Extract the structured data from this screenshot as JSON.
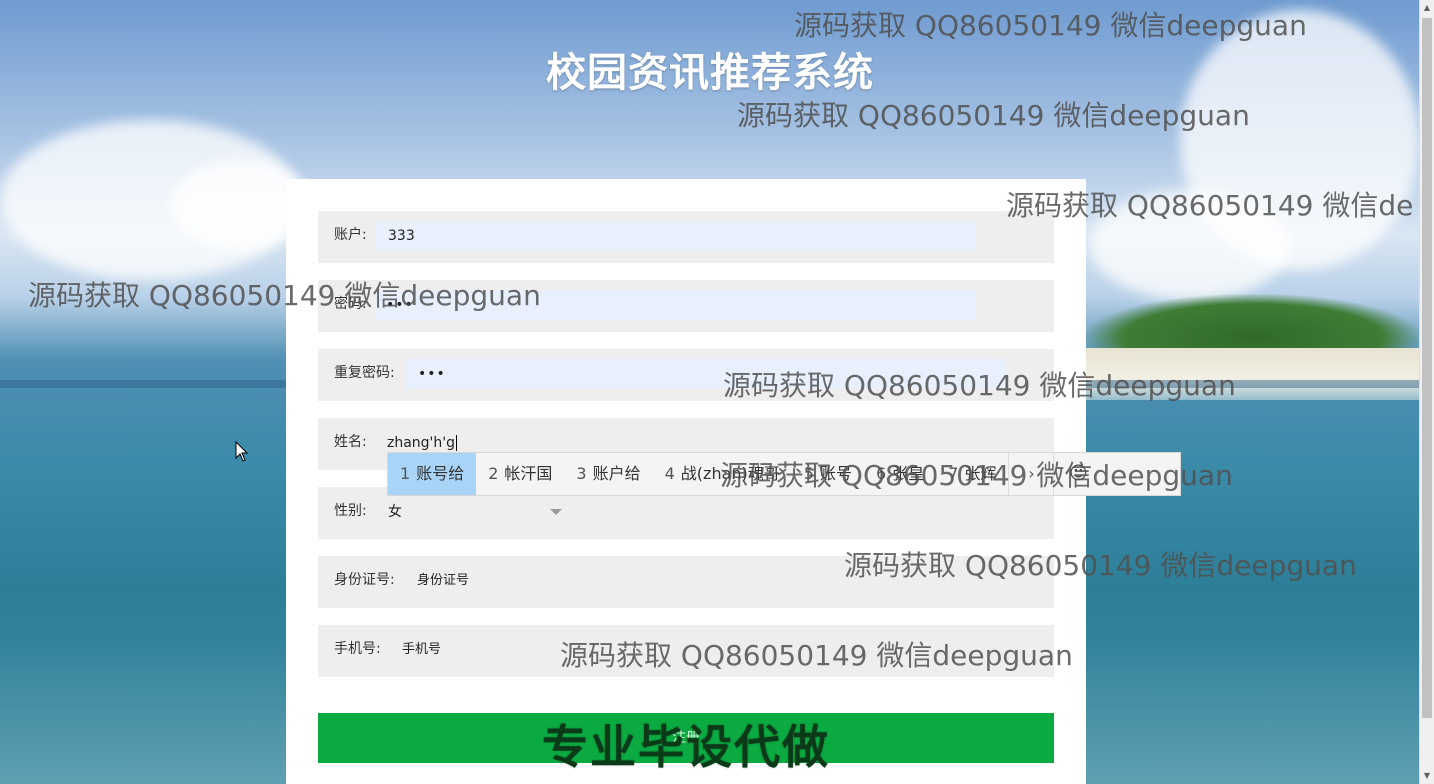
{
  "header": {
    "title": "校园资讯推荐系统"
  },
  "form": {
    "account": {
      "label": "账户:",
      "value": "333"
    },
    "password": {
      "label": "密码:",
      "value": "•••"
    },
    "confirm_password": {
      "label": "重复密码:",
      "value": "•••"
    },
    "name": {
      "label": "姓名:",
      "value": "zhang'h'g"
    },
    "gender": {
      "label": "性别:",
      "value": "女"
    },
    "id_card": {
      "label": "身份证号:",
      "placeholder": "身份证号"
    },
    "phone": {
      "label": "手机号:",
      "placeholder": "手机号"
    },
    "submit_label": "注册",
    "promo_text": "专业毕设代做"
  },
  "ime": {
    "candidates": [
      {
        "num": "1",
        "text": "账号给"
      },
      {
        "num": "2",
        "text": "帐汗国"
      },
      {
        "num": "3",
        "text": "账户给"
      },
      {
        "num": "4",
        "text": "战(zhan)魂哥"
      },
      {
        "num": "5",
        "text": "账号"
      },
      {
        "num": "6",
        "text": "张皇"
      },
      {
        "num": "7",
        "text": "张辉"
      }
    ],
    "next_glyph": "›",
    "emoji_glyph": "☺"
  },
  "watermarks": [
    "源码获取 QQ86050149 微信deepguan",
    "源码获取 QQ86050149 微信deepguan",
    "源码获取 QQ86050149 微信de",
    "源码获取 QQ86050149 微信deepguan",
    "源码获取 QQ86050149 微信deepguan",
    "源码获取 QQ86050149 微信deepguan",
    "源码获取 QQ86050149 微信deepguan",
    "源码获取 QQ86050149 微信deepguan"
  ],
  "icons": {
    "select_arrow": "chevron-down-icon",
    "mouse_pointer": "mouse-pointer-icon"
  }
}
